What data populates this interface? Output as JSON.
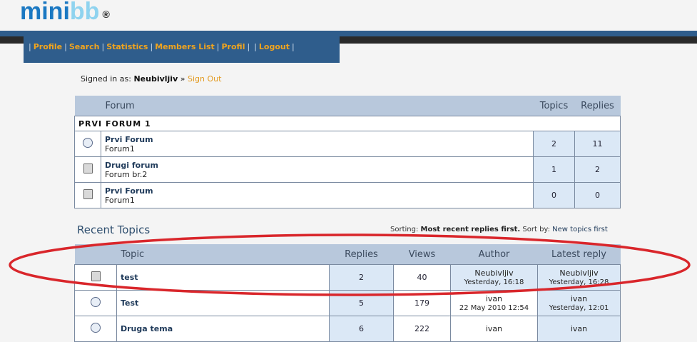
{
  "logo": {
    "part1": "mini",
    "part2": "bb",
    "reg": "®"
  },
  "nav": {
    "items": [
      "Profile",
      "Search",
      "Statistics",
      "Members List",
      "Profil",
      "Logout"
    ]
  },
  "user": {
    "prefix": "Signed in as:",
    "name": "Neubivljiv",
    "arrow": "»",
    "signout": "Sign Out"
  },
  "forum_table": {
    "headers": {
      "forum": "Forum",
      "topics": "Topics",
      "replies": "Replies"
    },
    "category": "PRVI FORUM 1",
    "rows": [
      {
        "title": "Prvi Forum",
        "desc": "Forum1",
        "topics": "2",
        "replies": "11"
      },
      {
        "title": "Drugi forum",
        "desc": "Forum br.2",
        "topics": "1",
        "replies": "2"
      },
      {
        "title": "Prvi Forum",
        "desc": "Forum1",
        "topics": "0",
        "replies": "0"
      }
    ]
  },
  "recent": {
    "title": "Recent Topics",
    "sorting_label": "Sorting:",
    "sorting_value": "Most recent replies first.",
    "sort_by_label": "Sort by:",
    "sort_by_link": "New topics first",
    "headers": {
      "topic": "Topic",
      "replies": "Replies",
      "views": "Views",
      "author": "Author",
      "latest": "Latest reply"
    },
    "rows": [
      {
        "topic": "test",
        "replies": "2",
        "views": "40",
        "author": "Neubivljiv",
        "author_date": "Yesterday, 16:18",
        "latest": "Neubivljiv",
        "latest_date": "Yesterday, 16:28"
      },
      {
        "topic": "Test",
        "replies": "5",
        "views": "179",
        "author": "ivan",
        "author_date": "22 May 2010 12:54",
        "latest": "ivan",
        "latest_date": "Yesterday, 12:01"
      },
      {
        "topic": "Druga tema",
        "replies": "6",
        "views": "222",
        "author": "ivan",
        "author_date": "",
        "latest": "ivan",
        "latest_date": ""
      }
    ]
  },
  "colors": {
    "annotation": "#d9262b",
    "nav_bg": "#2f5d8c",
    "link_orange": "#f0a41e"
  }
}
